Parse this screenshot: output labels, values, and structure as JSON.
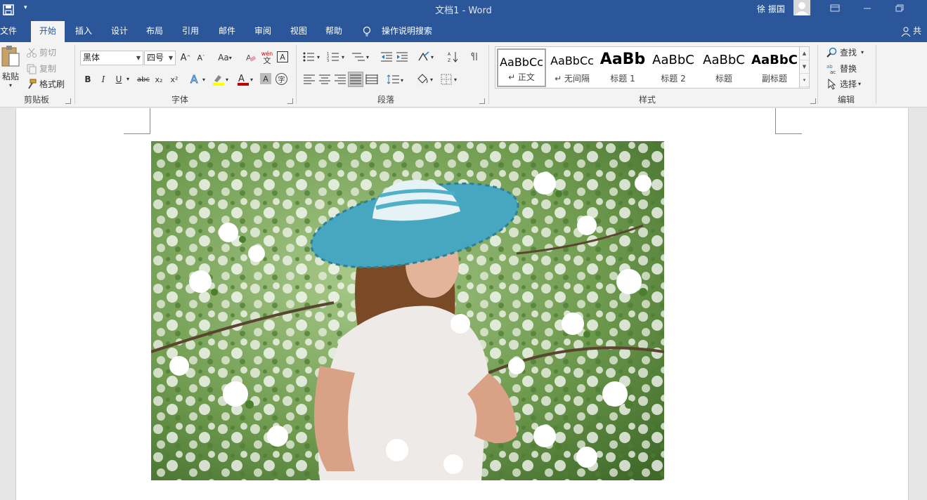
{
  "titlebar": {
    "doc_title": "文档1  -  Word",
    "user_name": "徐 振国"
  },
  "tabs": [
    {
      "label": "文件"
    },
    {
      "label": "开始"
    },
    {
      "label": "插入"
    },
    {
      "label": "设计"
    },
    {
      "label": "布局"
    },
    {
      "label": "引用"
    },
    {
      "label": "邮件"
    },
    {
      "label": "审阅"
    },
    {
      "label": "视图"
    },
    {
      "label": "帮助"
    }
  ],
  "tell_me": "操作说明搜索",
  "share": "共享",
  "clipboard": {
    "paste": "粘贴",
    "cut": "剪切",
    "copy": "复制",
    "format_painter": "格式刷",
    "label": "剪贴板"
  },
  "font": {
    "name": "黑体",
    "size": "四号",
    "label": "字体",
    "case_btn": "Aa",
    "bold": "B",
    "italic": "I",
    "underline": "U",
    "strike": "abc",
    "subscript": "x₂",
    "superscript": "x²",
    "phonetic": "wén",
    "phonetic_char": "文"
  },
  "paragraph": {
    "label": "段落"
  },
  "styles": {
    "label": "样式",
    "items": [
      {
        "sample": "AaBbCc",
        "name": "↵ 正文"
      },
      {
        "sample": "AaBbCc",
        "name": "↵ 无间隔"
      },
      {
        "sample": "AaBb",
        "name": "标题 1"
      },
      {
        "sample": "AaBbC",
        "name": "标题 2"
      },
      {
        "sample": "AaBbC",
        "name": "标题"
      },
      {
        "sample": "AaBbC",
        "name": "副标题"
      }
    ]
  },
  "editing": {
    "find": "查找",
    "replace": "替换",
    "select": "选择",
    "label": "编辑"
  },
  "colors": {
    "brand": "#2b579a",
    "ribbon": "#f3f3f3",
    "highlight": "#ffff00",
    "font_color": "#c00000"
  }
}
